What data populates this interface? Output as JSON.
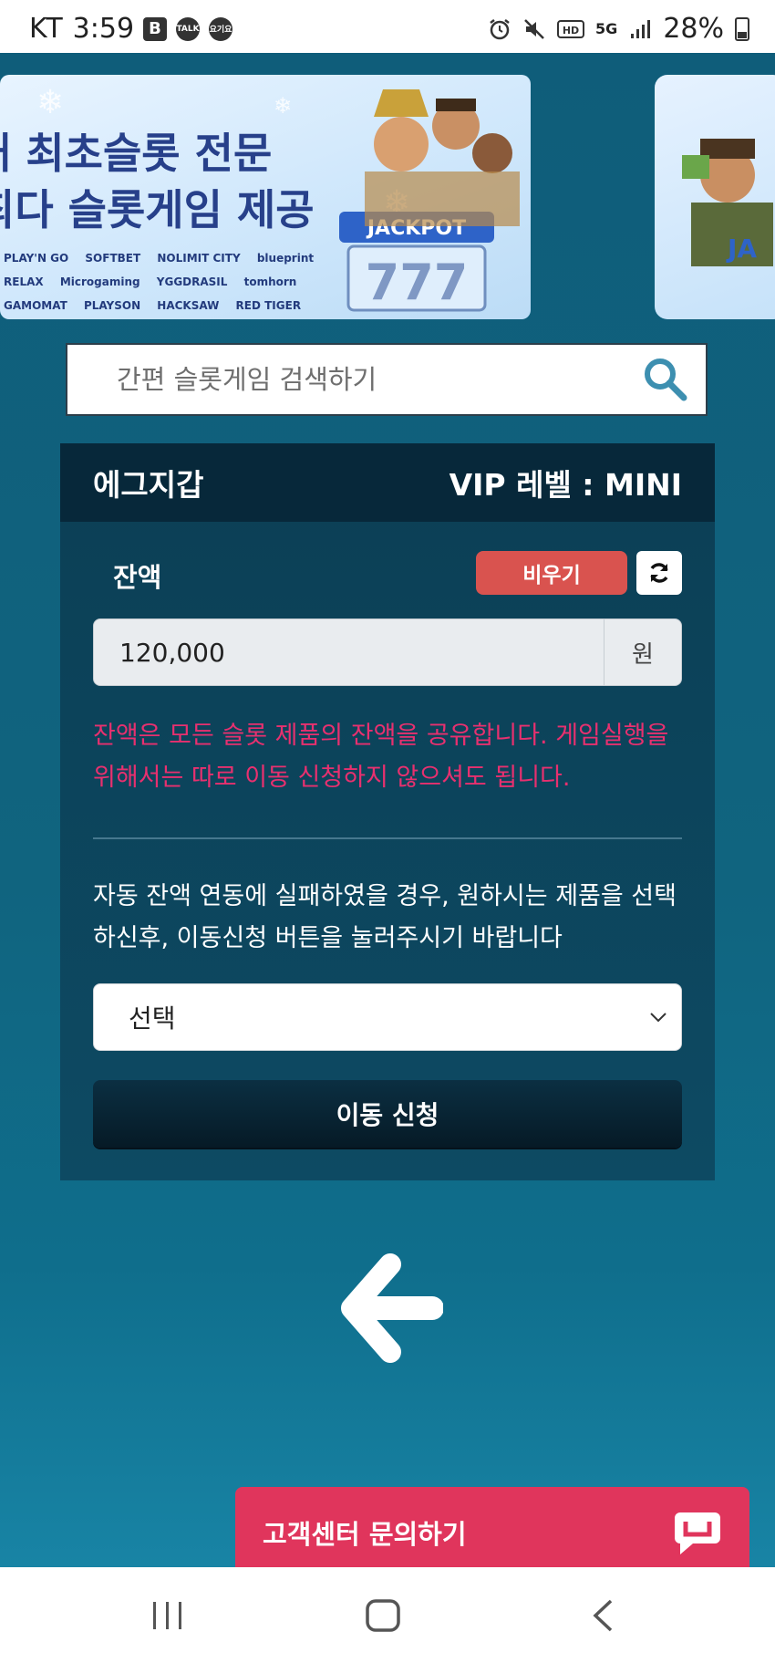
{
  "status_bar": {
    "carrier": "KT",
    "time": "3:59",
    "badge_b": "B",
    "badge_talk": "TALK",
    "badge_yogiyo": "요기요",
    "network": "5G",
    "battery": "28%"
  },
  "banner": {
    "line1": "내 최초슬롯 전문",
    "line2": "최다 슬롯게임 제공",
    "logos": [
      "PLAY'N GO",
      "SOFTBET",
      "NOLIMIT CITY",
      "blueprint",
      "RELAX",
      "Microgaming",
      "YGGDRASIL",
      "tomhorn",
      "GAMOMAT",
      "PLAYSON",
      "HACKSAW",
      "RED TIGER"
    ],
    "jackpot_text": "JACKPOT",
    "jackpot_number": "777"
  },
  "search": {
    "placeholder": "간편 슬롯게임 검색하기"
  },
  "wallet": {
    "title": "에그지갑",
    "vip_level": "VIP 레벨 : MINI",
    "balance_label": "잔액",
    "empty_button": "비우기",
    "amount": "120,000",
    "currency_unit": "원",
    "notice": "잔액은 모든 슬롯 제품의 잔액을 공유합니다. 게임실행을 위해서는 따로 이동 신청하지 않으셔도 됩니다.",
    "guide": "자동 잔액 연동에 실패하였을 경우, 원하시는 제품을 선택하신후, 이동신청 버튼을 눌러주시기 바랍니다",
    "select_value": "선택",
    "transfer_button": "이동 신청"
  },
  "customer_service": {
    "label": "고객센터 문의하기"
  },
  "colors": {
    "background": "#0f5e7a",
    "panel": "#0c3f55",
    "panel_header": "#07283a",
    "danger": "#d9534f",
    "notice_text": "#e8306f",
    "cs_button": "#e0355c"
  }
}
